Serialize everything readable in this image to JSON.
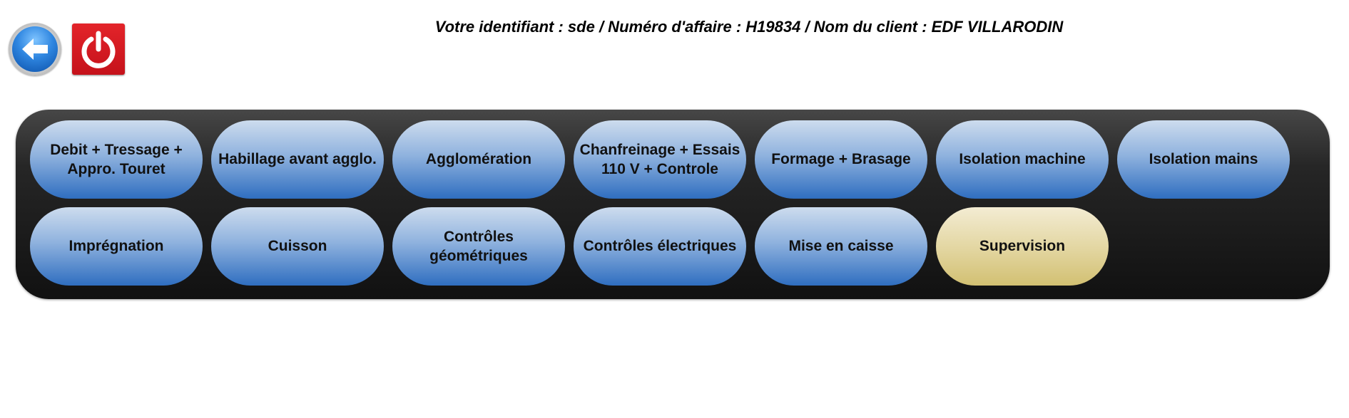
{
  "header": {
    "info_text": "Votre identifiant : sde / Numéro d'affaire : H19834 / Nom du client : EDF VILLARODIN"
  },
  "toolbar": {
    "back_icon": "arrow-left-icon",
    "power_icon": "power-icon"
  },
  "colors": {
    "button_blue": "#2f6ec0",
    "button_supervision": "#d2c072",
    "panel_dark": "#1a1a1a",
    "power_red": "#d51a21"
  },
  "menu": {
    "row1": [
      "Debit + Tressage + Appro. Touret",
      "Habillage avant agglo.",
      "Agglomération",
      "Chanfreinage + Essais 110 V + Controle",
      "Formage + Brasage",
      "Isolation machine",
      "Isolation mains"
    ],
    "row2": [
      "Imprégnation",
      "Cuisson",
      "Contrôles géométriques",
      "Contrôles électriques",
      "Mise en caisse",
      "Supervision"
    ]
  }
}
